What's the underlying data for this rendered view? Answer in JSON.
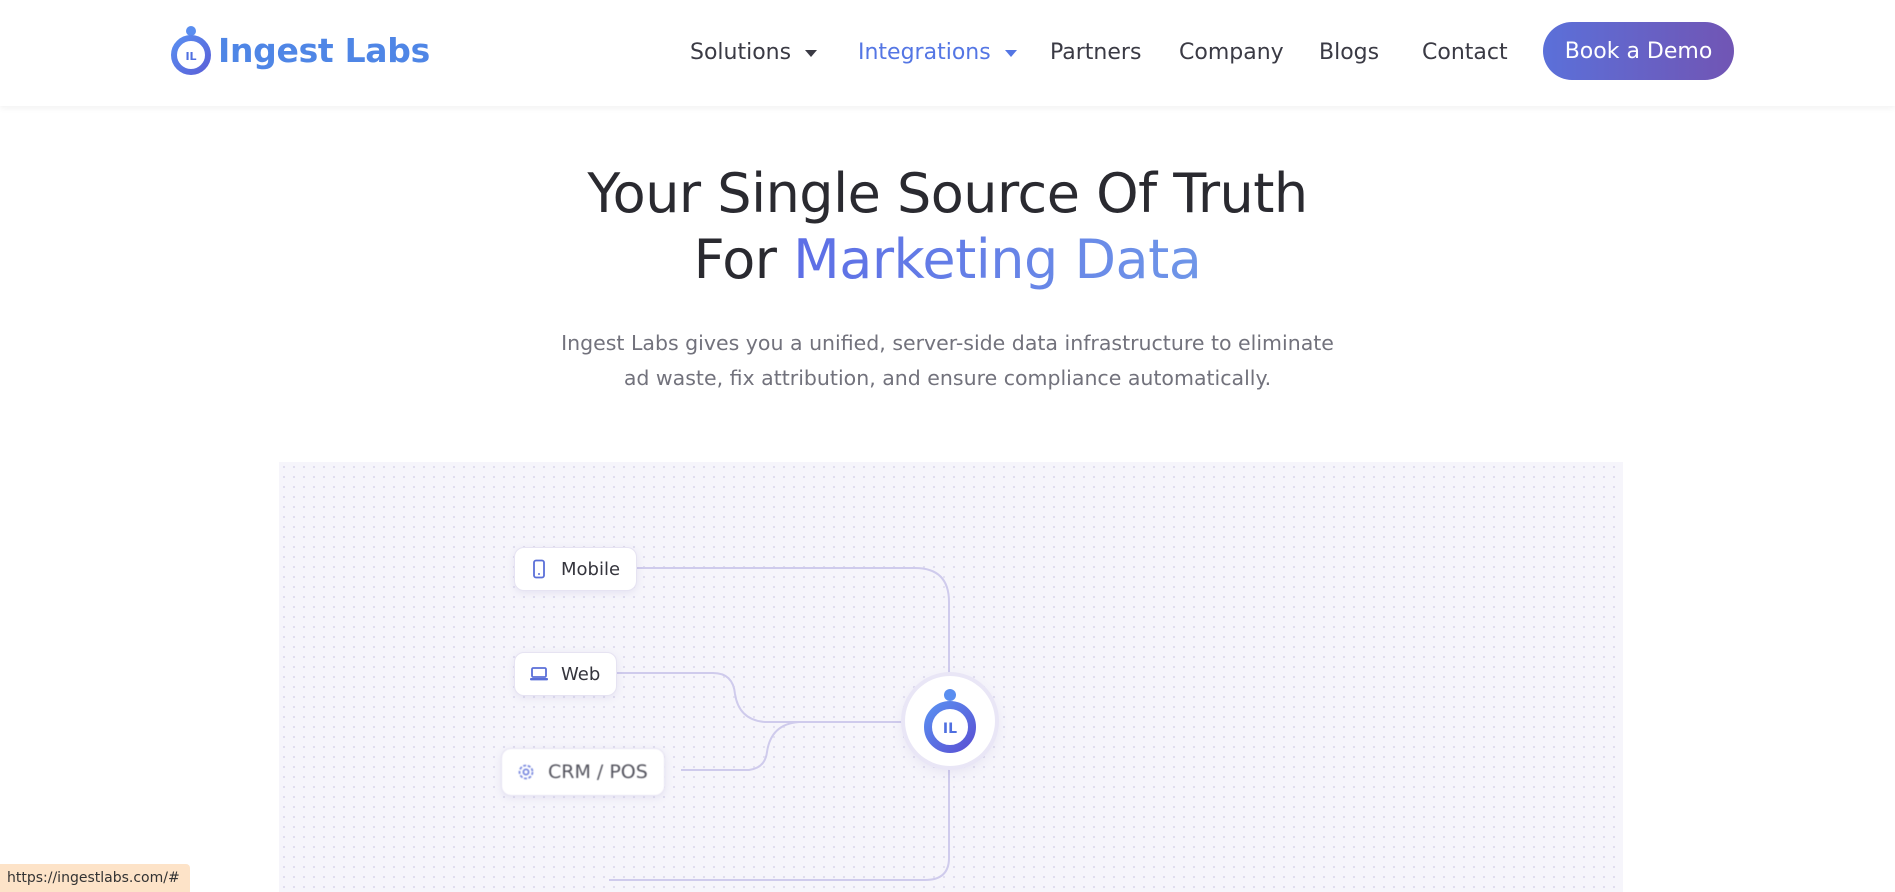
{
  "header": {
    "logo_text": "Ingest Labs",
    "logo_mark_text": "IL",
    "nav": [
      {
        "label": "Solutions",
        "has_dropdown": true,
        "active": false
      },
      {
        "label": "Integrations",
        "has_dropdown": true,
        "active": true
      },
      {
        "label": "Partners",
        "has_dropdown": false,
        "active": false
      },
      {
        "label": "Company",
        "has_dropdown": false,
        "active": false
      },
      {
        "label": "Blogs",
        "has_dropdown": false,
        "active": false
      },
      {
        "label": "Contact",
        "has_dropdown": false,
        "active": false
      }
    ],
    "cta_label": "Book a Demo"
  },
  "hero": {
    "title_line1": "Your Single Source Of Truth",
    "title_line2_prefix": "For ",
    "title_line2_highlight": "Marketing Data",
    "subtitle_line1": "Ingest Labs gives you a unified, server-side data infrastructure to eliminate",
    "subtitle_line2": "ad waste, fix attribution, and ensure compliance automatically."
  },
  "diagram": {
    "sources": [
      {
        "label": "Mobile",
        "icon": "mobile-icon"
      },
      {
        "label": "Web",
        "icon": "laptop-icon"
      },
      {
        "label": "CRM / POS",
        "icon": "gear-icon"
      }
    ],
    "hub_text": "IL"
  },
  "status_bar": {
    "url": "https://ingestlabs.com/#"
  },
  "colors": {
    "brand_blue": "#4f86e6",
    "active_nav": "#5476e4",
    "cta_start": "#5b70d9",
    "cta_end": "#7155b4",
    "connector": "#cfcbec"
  }
}
